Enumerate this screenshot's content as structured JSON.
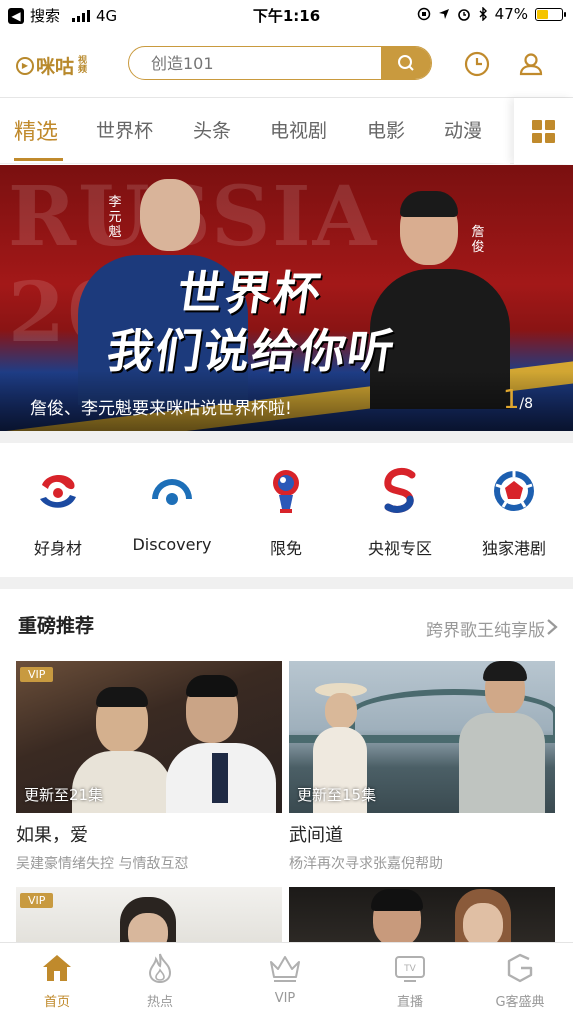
{
  "status_bar": {
    "back_label": "搜索",
    "network": "4G",
    "time": "下午1:16",
    "battery": "47%",
    "battery_level": 0.47
  },
  "header": {
    "logo_text": "咪咕",
    "logo_sub": "视频",
    "search_placeholder": "创造101",
    "history_icon": "clock-icon",
    "user_icon": "user-icon"
  },
  "tabs": [
    {
      "label": "精选",
      "active": true
    },
    {
      "label": "世界杯"
    },
    {
      "label": "头条"
    },
    {
      "label": "电视剧"
    },
    {
      "label": "电影"
    },
    {
      "label": "动漫"
    }
  ],
  "banner": {
    "bg_text": "RUSSIA 2018",
    "name_left": "李元魁",
    "name_right": "詹俊",
    "headline_line1": "世界杯",
    "headline_line2": "我们说给你听",
    "caption": "詹俊、李元魁要来咪咕说世界杯啦!",
    "page_current": "1",
    "page_total": "/8"
  },
  "categories": [
    {
      "label": "好身材",
      "icon": "fitness-logo-icon"
    },
    {
      "label": "Discovery",
      "icon": "discovery-logo-icon"
    },
    {
      "label": "限免",
      "icon": "worldcup-trophy-icon"
    },
    {
      "label": "央视专区",
      "icon": "cctv-logo-icon"
    },
    {
      "label": "独家港剧",
      "icon": "tvb-logo-icon"
    }
  ],
  "section": {
    "title": "重磅推荐",
    "more": "跨界歌王纯享版"
  },
  "cards": [
    {
      "vip": "VIP",
      "update": "更新至21集",
      "title": "如果，爱",
      "desc": "吴建豪情绪失控 与情敌互怼"
    },
    {
      "vip": "",
      "update": "更新至15集",
      "title": "武间道",
      "desc": "杨洋再次寻求张嘉倪帮助"
    },
    {
      "vip": "VIP",
      "update": "",
      "title": "",
      "desc": ""
    },
    {
      "vip": "",
      "update": "",
      "title": "",
      "desc": ""
    }
  ],
  "bottom_nav": [
    {
      "label": "首页",
      "icon": "home-icon",
      "active": true
    },
    {
      "label": "热点",
      "icon": "flame-icon"
    },
    {
      "label": "VIP",
      "icon": "crown-icon"
    },
    {
      "label": "直播",
      "icon": "tv-icon"
    },
    {
      "label": "G客盛典",
      "icon": "g-logo-icon"
    }
  ],
  "colors": {
    "accent": "#c08a2c",
    "tab_text": "#666666",
    "muted": "#999999"
  }
}
